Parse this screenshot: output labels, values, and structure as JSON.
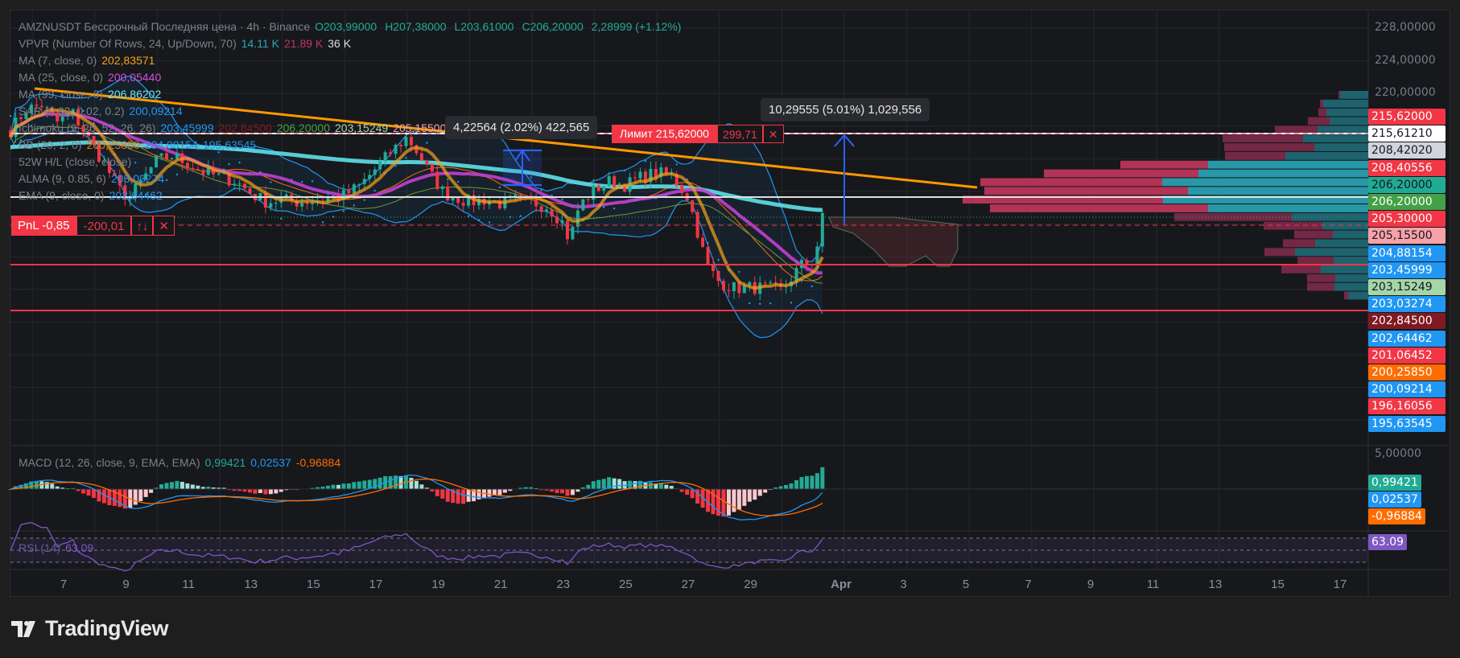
{
  "legend": {
    "symbol": "AMZNUSDT Бессрочный Последняя цена · 4h · Binance",
    "open": "O203,99000",
    "high": "H207,38000",
    "low": "L203,61000",
    "close": "C206,20000",
    "change": "2,28999 (+1.12%)",
    "vpvr": {
      "label": "VPVR (Number Of Rows, 24, Up/Down, 70)",
      "up": "14.11 K",
      "down": "21.89 K",
      "total": "36 K"
    },
    "ma7": {
      "label": "MA (7, close, 0)",
      "value": "202,83571"
    },
    "ma25": {
      "label": "MA (25, close, 0)",
      "value": "200,05440"
    },
    "ma99": {
      "label": "MA (99, close, 0)",
      "value": "206.86202"
    },
    "sar": {
      "label": "SAR (0.02, 0.02, 0.2)",
      "value": "200,09214"
    },
    "ichimoku": {
      "label": "Ichimoku (9, 26, 52, 26, 26)",
      "v1": "203,45999",
      "v2": "202,84500",
      "v3": "206,20000",
      "v4": "203,15249",
      "v5": "205,15500"
    },
    "bb": {
      "label": "BB (20, 2, 0)",
      "v1": "200,25850",
      "v2": "204,88154",
      "v3": "195,63545"
    },
    "w52": {
      "label": "52W H/L (close, close)"
    },
    "alma": {
      "label": "ALMA (9, 0.85, 6)",
      "value": "203,03274"
    },
    "ema": {
      "label": "EMA (9, close, 0)",
      "value": "202,64462"
    }
  },
  "orders": {
    "limit_label": "Лимит 215,62000",
    "limit_qty": "299,71",
    "pnl_label": "PnL -0,85",
    "pnl_value": "-200,01",
    "reverse_icon": "↑↓",
    "close_icon": "✕"
  },
  "measures": [
    {
      "text": "4,22564 (2.02%) 422,565"
    },
    {
      "text": "10,29555 (5.01%) 1,029,556"
    }
  ],
  "price_axis": {
    "ticks": [
      "228,00000",
      "224,00000",
      "220,00000"
    ],
    "labels": [
      {
        "text": "215,62000",
        "bg": "#f23645",
        "fg": "#ffffff"
      },
      {
        "text": "215,61210",
        "bg": "#ffffff",
        "fg": "#131722"
      },
      {
        "text": "208,42020",
        "bg": "#d1d4dc",
        "fg": "#131722"
      },
      {
        "text": "208,40556",
        "bg": "#f23645",
        "fg": "#ffffff"
      },
      {
        "text": "206,20000",
        "bg": "#22ab94",
        "fg": "#131722"
      },
      {
        "text": "206,20000",
        "bg": "#43a047",
        "fg": "#ffffff"
      },
      {
        "text": "205,30000",
        "bg": "#f23645",
        "fg": "#ffffff"
      },
      {
        "text": "205,15500",
        "bg": "#f7a1a8",
        "fg": "#131722"
      },
      {
        "text": "204,88154",
        "bg": "#2196f3",
        "fg": "#ffffff"
      },
      {
        "text": "203,45999",
        "bg": "#2196f3",
        "fg": "#ffffff"
      },
      {
        "text": "203,15249",
        "bg": "#a5d6a7",
        "fg": "#131722"
      },
      {
        "text": "203,03274",
        "bg": "#2196f3",
        "fg": "#ffffff"
      },
      {
        "text": "202,84500",
        "bg": "#801922",
        "fg": "#ffffff"
      },
      {
        "text": "202,64462",
        "bg": "#2196f3",
        "fg": "#ffffff"
      },
      {
        "text": "201,06452",
        "bg": "#f23645",
        "fg": "#ffffff"
      },
      {
        "text": "200,25850",
        "bg": "#ff6d00",
        "fg": "#ffffff"
      },
      {
        "text": "200,09214",
        "bg": "#2196f3",
        "fg": "#ffffff"
      },
      {
        "text": "196,16056",
        "bg": "#f23645",
        "fg": "#ffffff"
      },
      {
        "text": "195,63545",
        "bg": "#2196f3",
        "fg": "#ffffff"
      }
    ],
    "macd_tick": "5,00000",
    "macd_labels": [
      {
        "text": "0,99421",
        "bg": "#22ab94"
      },
      {
        "text": "0,02537",
        "bg": "#2196f3"
      },
      {
        "text": "-0,96884",
        "bg": "#ff6d00"
      }
    ],
    "rsi_label": {
      "text": "63.09",
      "bg": "#7e57c2"
    }
  },
  "macd": {
    "label": "MACD (12, 26, close, 9, EMA, EMA)",
    "hist": "0,99421",
    "macd": "0,02537",
    "signal": "-0,96884"
  },
  "rsi": {
    "label": "RSI (14)",
    "value": "63.09"
  },
  "time_axis": [
    "7",
    "9",
    "11",
    "13",
    "15",
    "17",
    "19",
    "21",
    "23",
    "25",
    "27",
    "29",
    "Apr",
    "3",
    "5",
    "7",
    "9",
    "11",
    "13",
    "15",
    "17"
  ],
  "brand": "TradingView",
  "chart_data": {
    "type": "candlestick",
    "price_keypoints": [
      [
        5.3,
        216
      ],
      [
        5.8,
        218.5
      ],
      [
        6.3,
        219
      ],
      [
        6.8,
        217
      ],
      [
        7.3,
        218
      ],
      [
        7.8,
        215
      ],
      [
        8.3,
        212
      ],
      [
        8.8,
        209
      ],
      [
        9.1,
        208
      ],
      [
        9.5,
        210
      ],
      [
        10,
        212.5
      ],
      [
        10.5,
        213
      ],
      [
        11,
        212
      ],
      [
        11.5,
        211
      ],
      [
        12,
        210.5
      ],
      [
        12.5,
        210
      ],
      [
        13,
        208.5
      ],
      [
        13.5,
        207.5
      ],
      [
        14,
        207.8
      ],
      [
        14.5,
        207.5
      ],
      [
        15,
        207.7
      ],
      [
        15.5,
        208
      ],
      [
        16,
        208.3
      ],
      [
        16.5,
        209.5
      ],
      [
        17,
        211.5
      ],
      [
        17.5,
        213.5
      ],
      [
        18,
        215.2
      ],
      [
        18.4,
        213
      ],
      [
        18.8,
        210.5
      ],
      [
        19.2,
        208.5
      ],
      [
        19.6,
        208
      ],
      [
        20,
        207.5
      ],
      [
        20.5,
        207.8
      ],
      [
        21,
        207.3
      ],
      [
        21.5,
        207.8
      ],
      [
        22,
        207.5
      ],
      [
        22.5,
        207
      ],
      [
        23,
        205
      ],
      [
        23.2,
        202.8
      ],
      [
        23.5,
        207
      ],
      [
        24,
        209
      ],
      [
        24.5,
        210
      ],
      [
        25,
        209.5
      ],
      [
        25.5,
        210.5
      ],
      [
        26,
        211
      ],
      [
        26.5,
        210.5
      ],
      [
        27,
        208
      ],
      [
        27.3,
        204
      ],
      [
        27.6,
        200
      ],
      [
        28,
        198
      ],
      [
        28.5,
        197.3
      ],
      [
        29,
        197.4
      ],
      [
        29.5,
        197.3
      ],
      [
        30,
        197
      ],
      [
        30.3,
        198.5
      ],
      [
        30.6,
        200
      ],
      [
        31,
        200.5
      ],
      [
        31.4,
        206.2
      ]
    ],
    "vpvr_rows_up_down": [
      [
        35,
        2
      ],
      [
        56,
        4
      ],
      [
        52,
        10
      ],
      [
        48,
        27
      ],
      [
        63,
        53
      ],
      [
        81,
        100
      ],
      [
        67,
        112
      ],
      [
        103,
        75
      ],
      [
        199,
        109
      ],
      [
        211,
        192
      ],
      [
        256,
        226
      ],
      [
        224,
        253
      ],
      [
        255,
        249
      ],
      [
        199,
        271
      ],
      [
        95,
        146
      ],
      [
        57,
        73
      ],
      [
        44,
        48
      ],
      [
        66,
        40
      ],
      [
        91,
        38
      ],
      [
        43,
        45
      ],
      [
        59,
        49
      ],
      [
        41,
        35
      ],
      [
        42,
        34
      ],
      [
        25,
        5
      ]
    ],
    "colors": {
      "up": "#22ab94",
      "down": "#f23645",
      "ma7": "#f7a21b",
      "ma25": "#c040d0",
      "ma99": "#5ee0e8",
      "bb": "#2196f3",
      "trend": "#ff9800"
    }
  }
}
